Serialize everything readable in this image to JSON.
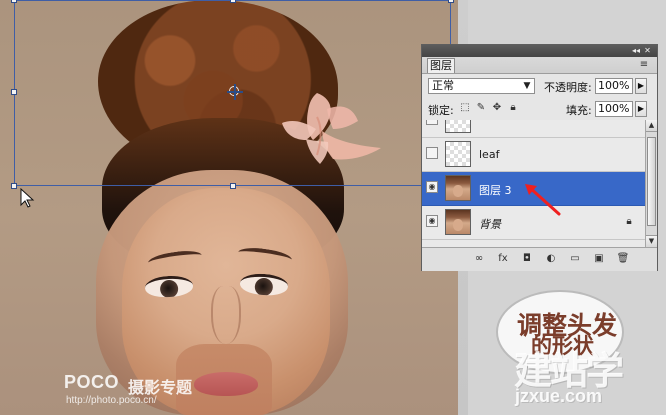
{
  "layers_panel": {
    "tab_label": "图层",
    "blend_mode": "正常",
    "opacity_label": "不透明度:",
    "opacity_value": "100%",
    "lock_label": "锁定:",
    "fill_label": "填充:",
    "fill_value": "100%",
    "layers": [
      {
        "name": "",
        "selected": false,
        "visible": false
      },
      {
        "name": "leaf",
        "selected": false,
        "visible": false
      },
      {
        "name": "图层 3",
        "selected": true,
        "visible": true
      },
      {
        "name": "背景",
        "selected": false,
        "visible": true
      }
    ]
  },
  "annotation": {
    "line1": "调整头发",
    "line2": "的形状"
  },
  "watermark": {
    "brand": "POCO",
    "channel": "摄影专题",
    "url": "http://photo.poco.cn/"
  },
  "site_logo": {
    "main": "建站学",
    "url": "jzxue.com"
  },
  "icons": {
    "panel_minimize": "panel-minimize-icon",
    "panel_close": "panel-close-icon",
    "panel_menu": "panel-menu-icon",
    "eye": "eye-icon",
    "lock_transparent": "lock-transparent-pixels-icon",
    "lock_image": "lock-image-pixels-icon",
    "lock_position": "lock-position-icon",
    "lock_all": "lock-all-icon",
    "link": "link-icon",
    "fx": "fx-icon",
    "mask": "mask-icon",
    "adjustment": "adjustment-layer-icon",
    "group": "group-icon",
    "new_layer": "new-layer-icon",
    "trash": "trash-icon"
  },
  "colors": {
    "selection_blue": "#3868c8",
    "annotation_brown": "#7b3d2b",
    "red_arrow": "#ef2020"
  }
}
